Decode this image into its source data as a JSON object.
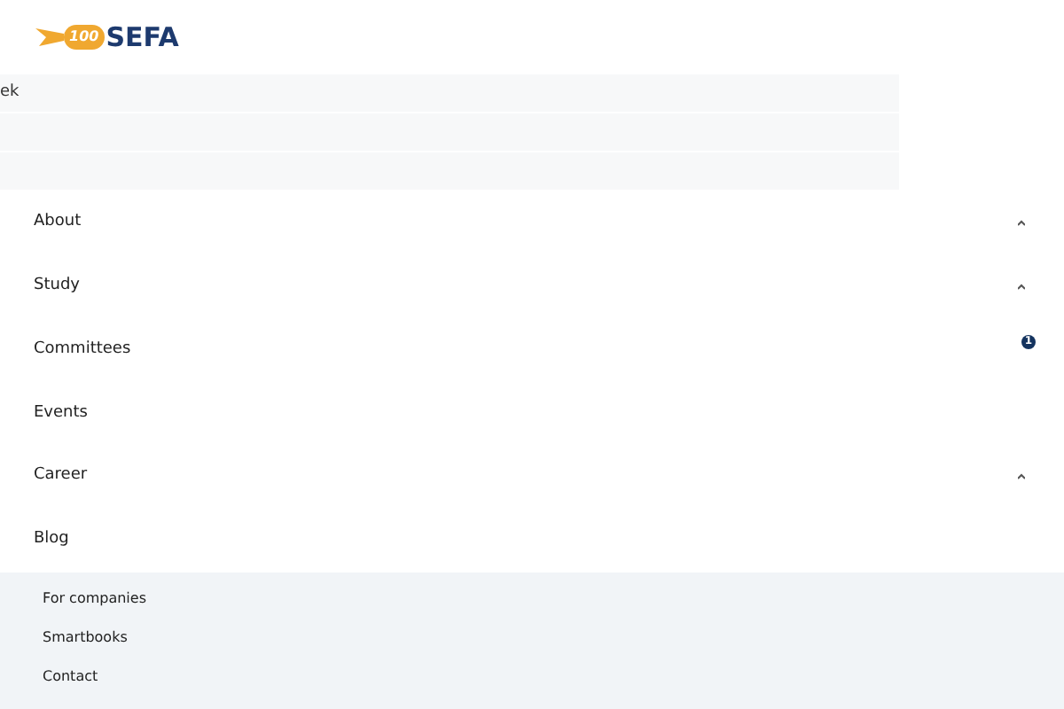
{
  "logo": {
    "badge": "100",
    "text": "SEFA"
  },
  "top_rows": [
    {
      "text": "ek"
    },
    {
      "text": null
    },
    {
      "text": null
    }
  ],
  "menu": [
    {
      "label": "About",
      "expandable": true
    },
    {
      "label": "Study",
      "expandable": true
    },
    {
      "label": "Committees",
      "expandable": false,
      "badge": "1"
    },
    {
      "label": "Events",
      "expandable": false
    },
    {
      "label": "Career",
      "expandable": true
    },
    {
      "label": "Blog",
      "expandable": false
    }
  ],
  "secondary_menu": [
    "For companies",
    "Smartbooks",
    "Contact"
  ]
}
